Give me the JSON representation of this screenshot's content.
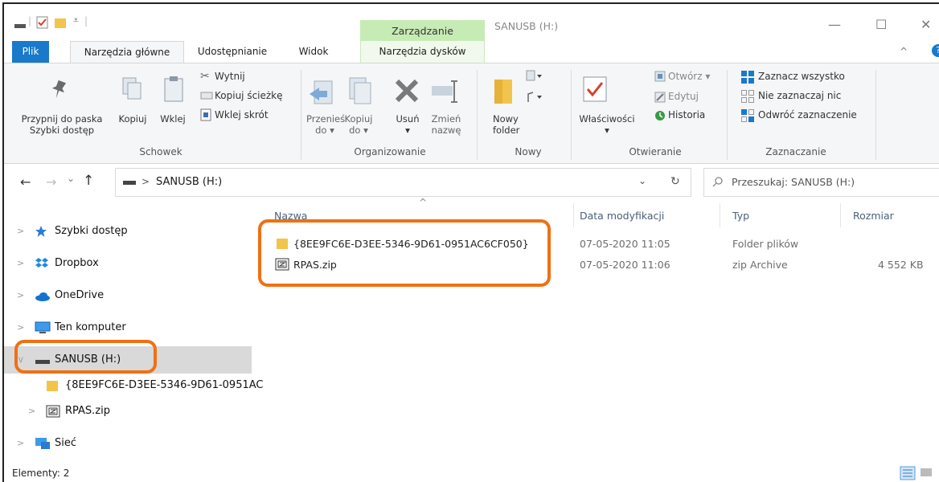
{
  "window": {
    "context_tab": "Zarządzanie",
    "title": "SANUSB (H:)",
    "minimize": "—",
    "maximize": "☐",
    "close": "✕"
  },
  "tabs": {
    "plik": "Plik",
    "home": "Narzędzia główne",
    "share": "Udostępnianie",
    "view": "Widok",
    "drive_tools": "Narzędzia dysków",
    "collapse": "^",
    "help": "?"
  },
  "ribbon": {
    "schowek": {
      "pin_line1": "Przypnij do paska",
      "pin_line2": "Szybki dostęp",
      "copy": "Kopiuj",
      "paste": "Wklej",
      "cut": "Wytnij",
      "copy_path": "Kopiuj ścieżkę",
      "paste_shortcut": "Wklej skrót",
      "label": "Schowek"
    },
    "organizowanie": {
      "move_line1": "Przenieś",
      "move_line2": "do ▾",
      "copyto_line1": "Kopiuj",
      "copyto_line2": "do ▾",
      "delete_line1": "Usuń",
      "delete_line2": "▾",
      "rename_line1": "Zmień",
      "rename_line2": "nazwę",
      "label": "Organizowanie"
    },
    "nowy": {
      "new_folder_line1": "Nowy",
      "new_folder_line2": "folder",
      "label": "Nowy"
    },
    "otwieranie": {
      "properties_line1": "Właściwości",
      "properties_line2": "▾",
      "open": "Otwórz ▾",
      "edit": "Edytuj",
      "history": "Historia",
      "label": "Otwieranie"
    },
    "zaznaczanie": {
      "select_all": "Zaznacz wszystko",
      "select_none": "Nie zaznaczaj nic",
      "invert": "Odwróć zaznaczenie",
      "label": "Zaznaczanie"
    }
  },
  "address": {
    "back": "←",
    "forward": "→",
    "recent": "⌄",
    "up": "↑",
    "path_sep": ">",
    "path": "SANUSB (H:)",
    "dropdown": "⌄",
    "refresh": "↻",
    "search_placeholder": "Przeszukaj: SANUSB (H:)"
  },
  "nav": {
    "items": [
      {
        "label": "Szybki dostęp"
      },
      {
        "label": "Dropbox"
      },
      {
        "label": "OneDrive"
      },
      {
        "label": "Ten komputer"
      },
      {
        "label": "SANUSB (H:)"
      },
      {
        "label": "{8EE9FC6E-D3EE-5346-9D61-0951AC"
      },
      {
        "label": "RPAS.zip"
      },
      {
        "label": "Sieć"
      }
    ]
  },
  "list": {
    "sort_indicator": "^",
    "columns": {
      "name": "Nazwa",
      "date": "Data modyfikacji",
      "type": "Typ",
      "size": "Rozmiar"
    },
    "rows": [
      {
        "name": "{8EE9FC6E-D3EE-5346-9D61-0951AC6CF050}",
        "date": "07-05-2020 11:05",
        "type": "Folder plików",
        "size": ""
      },
      {
        "name": "RPAS.zip",
        "date": "07-05-2020 11:06",
        "type": "zip Archive",
        "size": "4 552 KB"
      }
    ]
  },
  "status": {
    "count": "Elementy: 2"
  },
  "colors": {
    "accent": "#1979ca",
    "context_tab": "#c7ebb5",
    "highlight": "#f07014",
    "folder": "#f3c44b"
  }
}
